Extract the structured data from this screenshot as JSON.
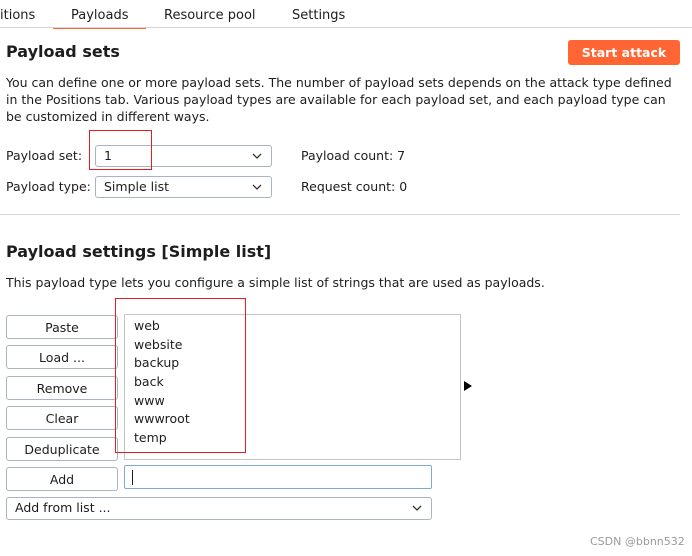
{
  "tabs": [
    {
      "label": "itions"
    },
    {
      "label": "Payloads"
    },
    {
      "label": "Resource pool"
    },
    {
      "label": "Settings"
    }
  ],
  "payload_sets": {
    "title": "Payload sets",
    "start_attack_label": "Start attack",
    "description_lines": [
      "You can define one or more payload sets. The number of payload sets depends on the attack type defined",
      "in the Positions tab. Various payload types are available for each payload set, and each payload type can",
      "be customized in different ways."
    ],
    "payload_set_label": "Payload set:",
    "payload_set_value": "1",
    "payload_type_label": "Payload type:",
    "payload_type_value": "Simple list",
    "payload_count": "Payload count: 7",
    "request_count": "Request count: 0"
  },
  "payload_settings": {
    "title": "Payload settings [Simple list]",
    "description": "This payload type lets you configure a simple list of strings that are used as payloads.",
    "buttons": [
      "Paste",
      "Load ...",
      "Remove",
      "Clear",
      "Deduplicate",
      "Add"
    ],
    "items": [
      "web",
      "website",
      "backup",
      "back",
      "www",
      "wwwroot",
      "temp"
    ],
    "add_input_value": "",
    "add_from_list_label": "Add from list ..."
  },
  "watermark": "CSDN @bbnn532",
  "colors": {
    "accent": "#ff6633",
    "highlight_box": "#e02020"
  },
  "icons": {
    "dropdown": "chevron-down-icon",
    "expand": "triangle-right-icon"
  }
}
